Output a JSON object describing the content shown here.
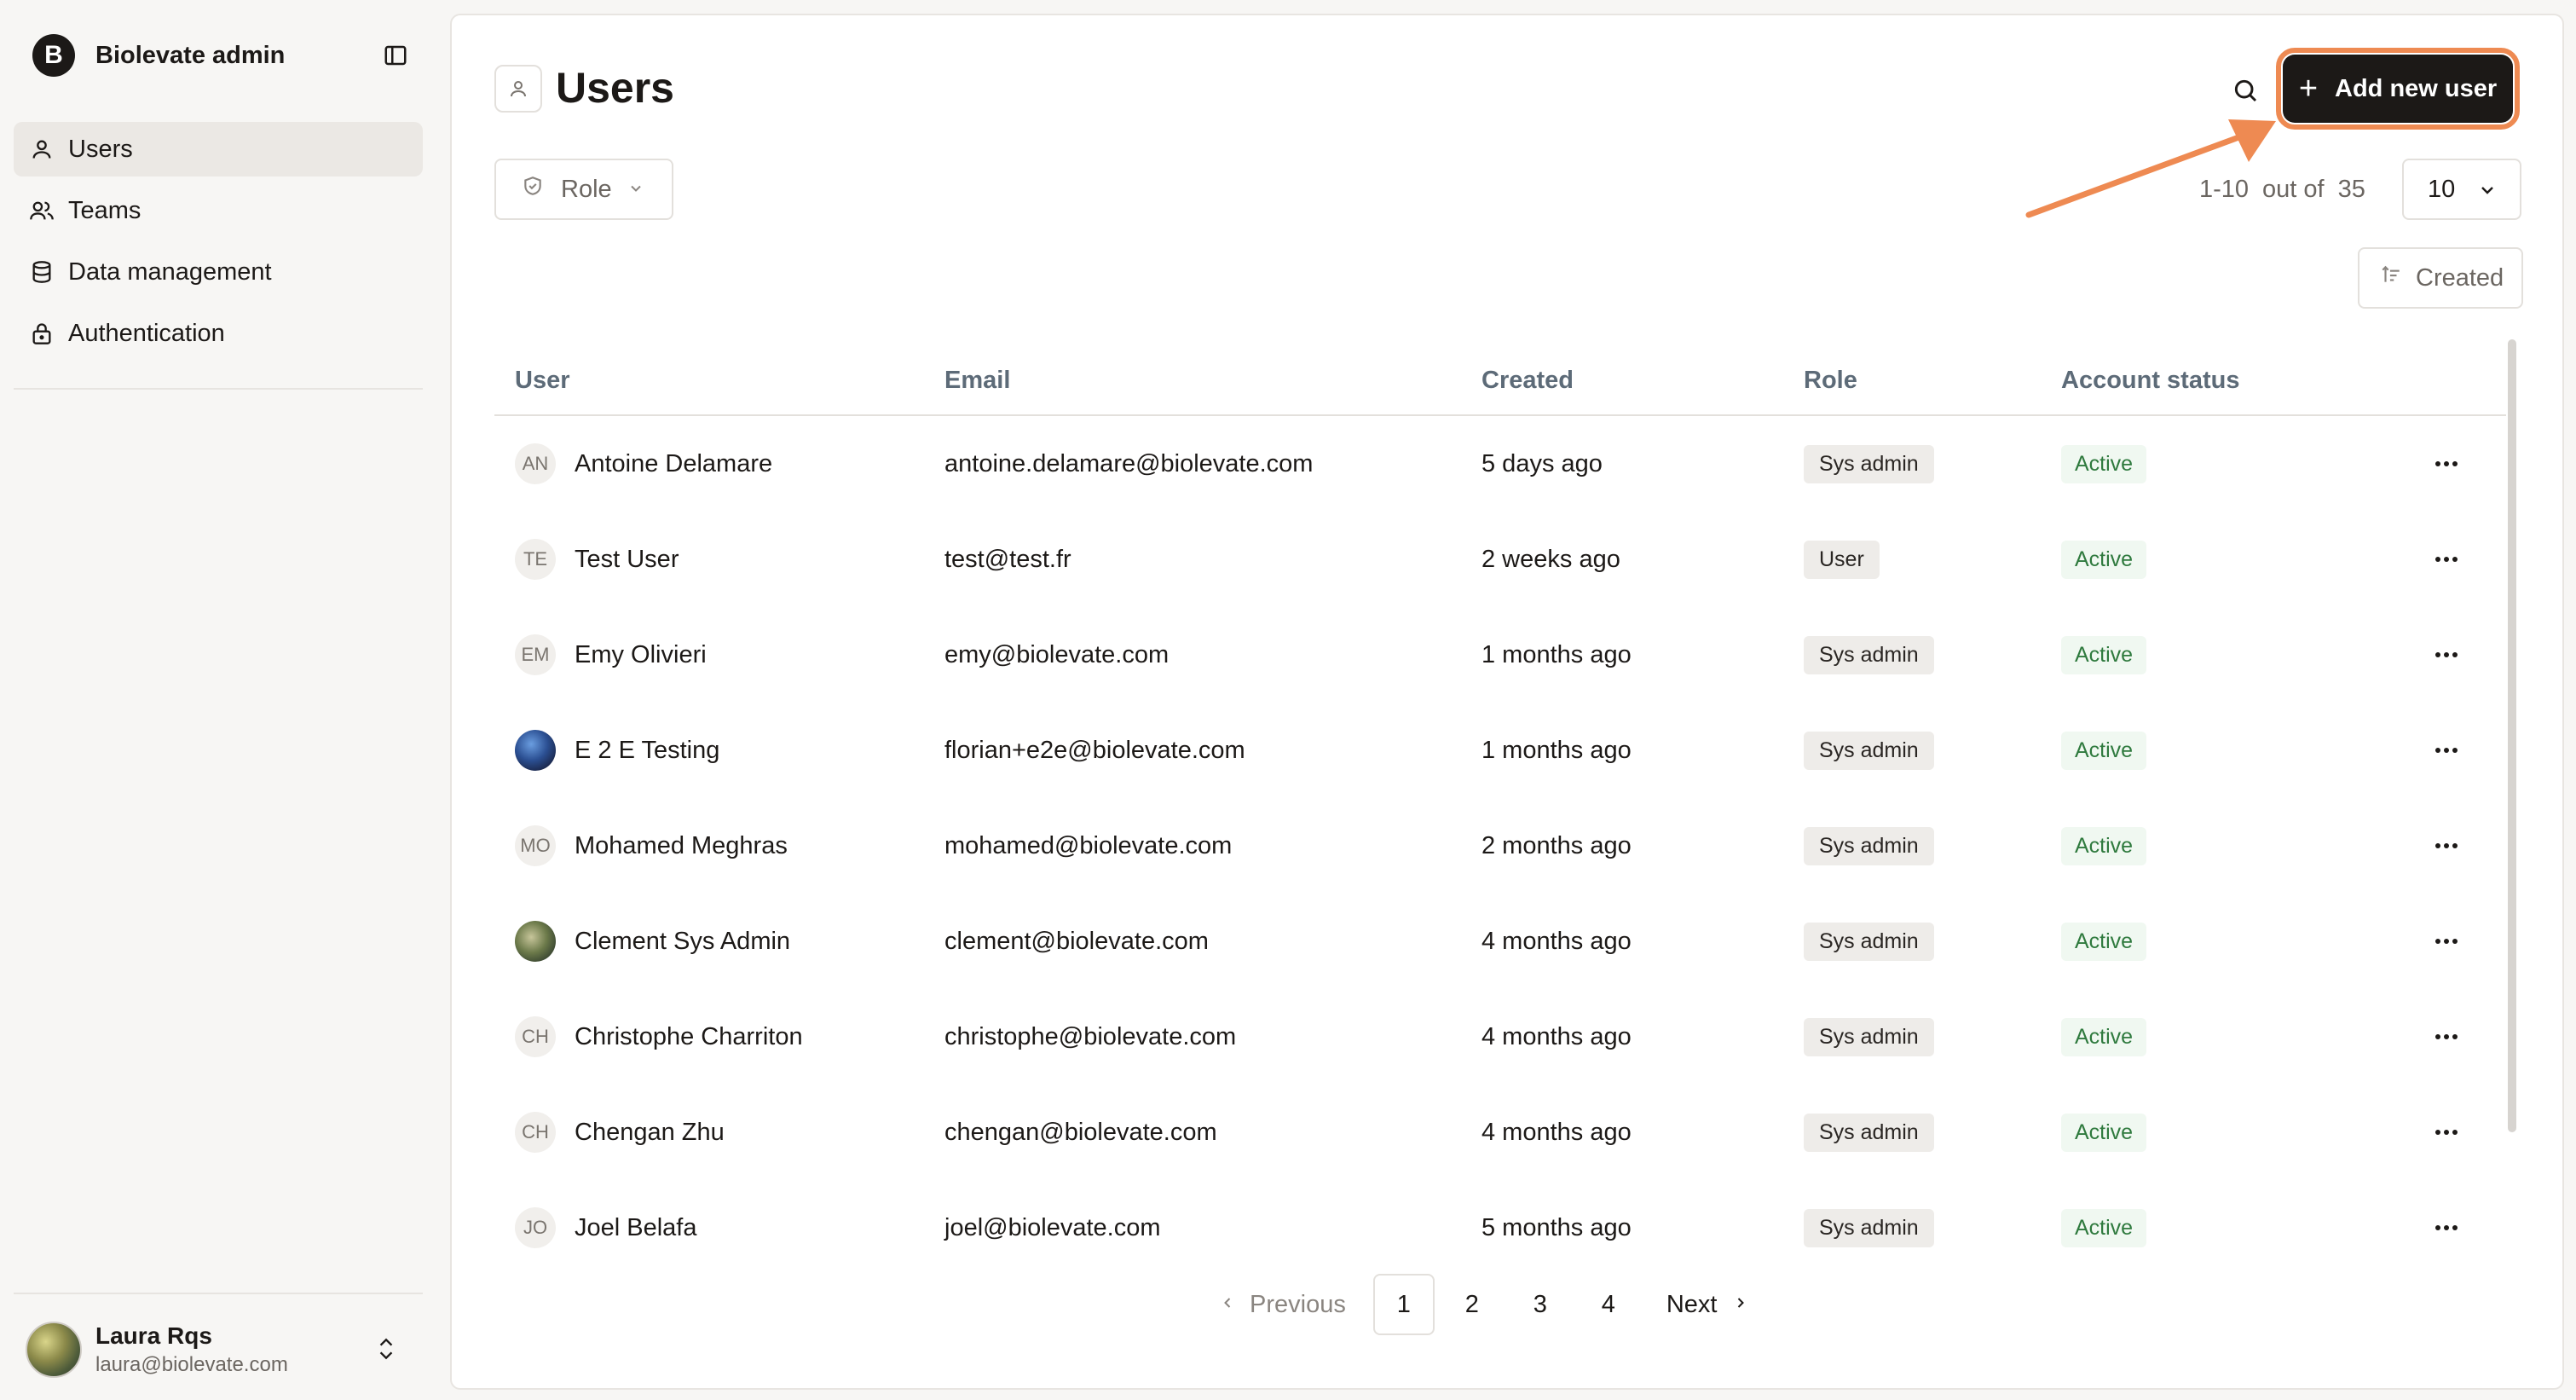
{
  "sidebar": {
    "brand_letter": "B",
    "brand_name": "Biolevate admin",
    "items": [
      {
        "label": "Users",
        "icon": "user-icon",
        "active": true
      },
      {
        "label": "Teams",
        "icon": "users-icon",
        "active": false
      },
      {
        "label": "Data management",
        "icon": "database-icon",
        "active": false
      },
      {
        "label": "Authentication",
        "icon": "lock-icon",
        "active": false
      }
    ],
    "profile": {
      "name": "Laura Rqs",
      "email": "laura@biolevate.com"
    }
  },
  "header": {
    "title": "Users",
    "add_button_label": "Add new user",
    "highlight_color": "#ee8a52"
  },
  "filters": {
    "role_label": "Role",
    "summary_range": "1-10",
    "summary_outof": "out of",
    "summary_total": "35",
    "page_size": "10",
    "sort_label": "Created"
  },
  "table": {
    "headers": {
      "user": "User",
      "email": "Email",
      "created": "Created",
      "role": "Role",
      "status": "Account status"
    },
    "rows": [
      {
        "initials": "AN",
        "avatar": "initials",
        "name": "Antoine Delamare",
        "email": "antoine.delamare@biolevate.com",
        "created": "5 days ago",
        "role": "Sys admin",
        "status": "Active"
      },
      {
        "initials": "TE",
        "avatar": "initials",
        "name": "Test User",
        "email": "test@test.fr",
        "created": "2 weeks ago",
        "role": "User",
        "status": "Active"
      },
      {
        "initials": "EM",
        "avatar": "initials",
        "name": "Emy Olivieri",
        "email": "emy@biolevate.com",
        "created": "1 months ago",
        "role": "Sys admin",
        "status": "Active"
      },
      {
        "initials": "",
        "avatar": "image-blue",
        "name": "E 2 E Testing",
        "email": "florian+e2e@biolevate.com",
        "created": "1 months ago",
        "role": "Sys admin",
        "status": "Active"
      },
      {
        "initials": "MO",
        "avatar": "initials",
        "name": "Mohamed Meghras",
        "email": "mohamed@biolevate.com",
        "created": "2 months ago",
        "role": "Sys admin",
        "status": "Active"
      },
      {
        "initials": "",
        "avatar": "image-olive",
        "name": "Clement Sys Admin",
        "email": "clement@biolevate.com",
        "created": "4 months ago",
        "role": "Sys admin",
        "status": "Active"
      },
      {
        "initials": "CH",
        "avatar": "initials",
        "name": "Christophe Charriton",
        "email": "christophe@biolevate.com",
        "created": "4 months ago",
        "role": "Sys admin",
        "status": "Active"
      },
      {
        "initials": "CH",
        "avatar": "initials",
        "name": "Chengan Zhu",
        "email": "chengan@biolevate.com",
        "created": "4 months ago",
        "role": "Sys admin",
        "status": "Active"
      },
      {
        "initials": "JO",
        "avatar": "initials",
        "name": "Joel Belafa",
        "email": "joel@biolevate.com",
        "created": "5 months ago",
        "role": "Sys admin",
        "status": "Active"
      }
    ]
  },
  "pager": {
    "previous_label": "Previous",
    "next_label": "Next",
    "pages": [
      "1",
      "2",
      "3",
      "4"
    ],
    "current": "1"
  }
}
